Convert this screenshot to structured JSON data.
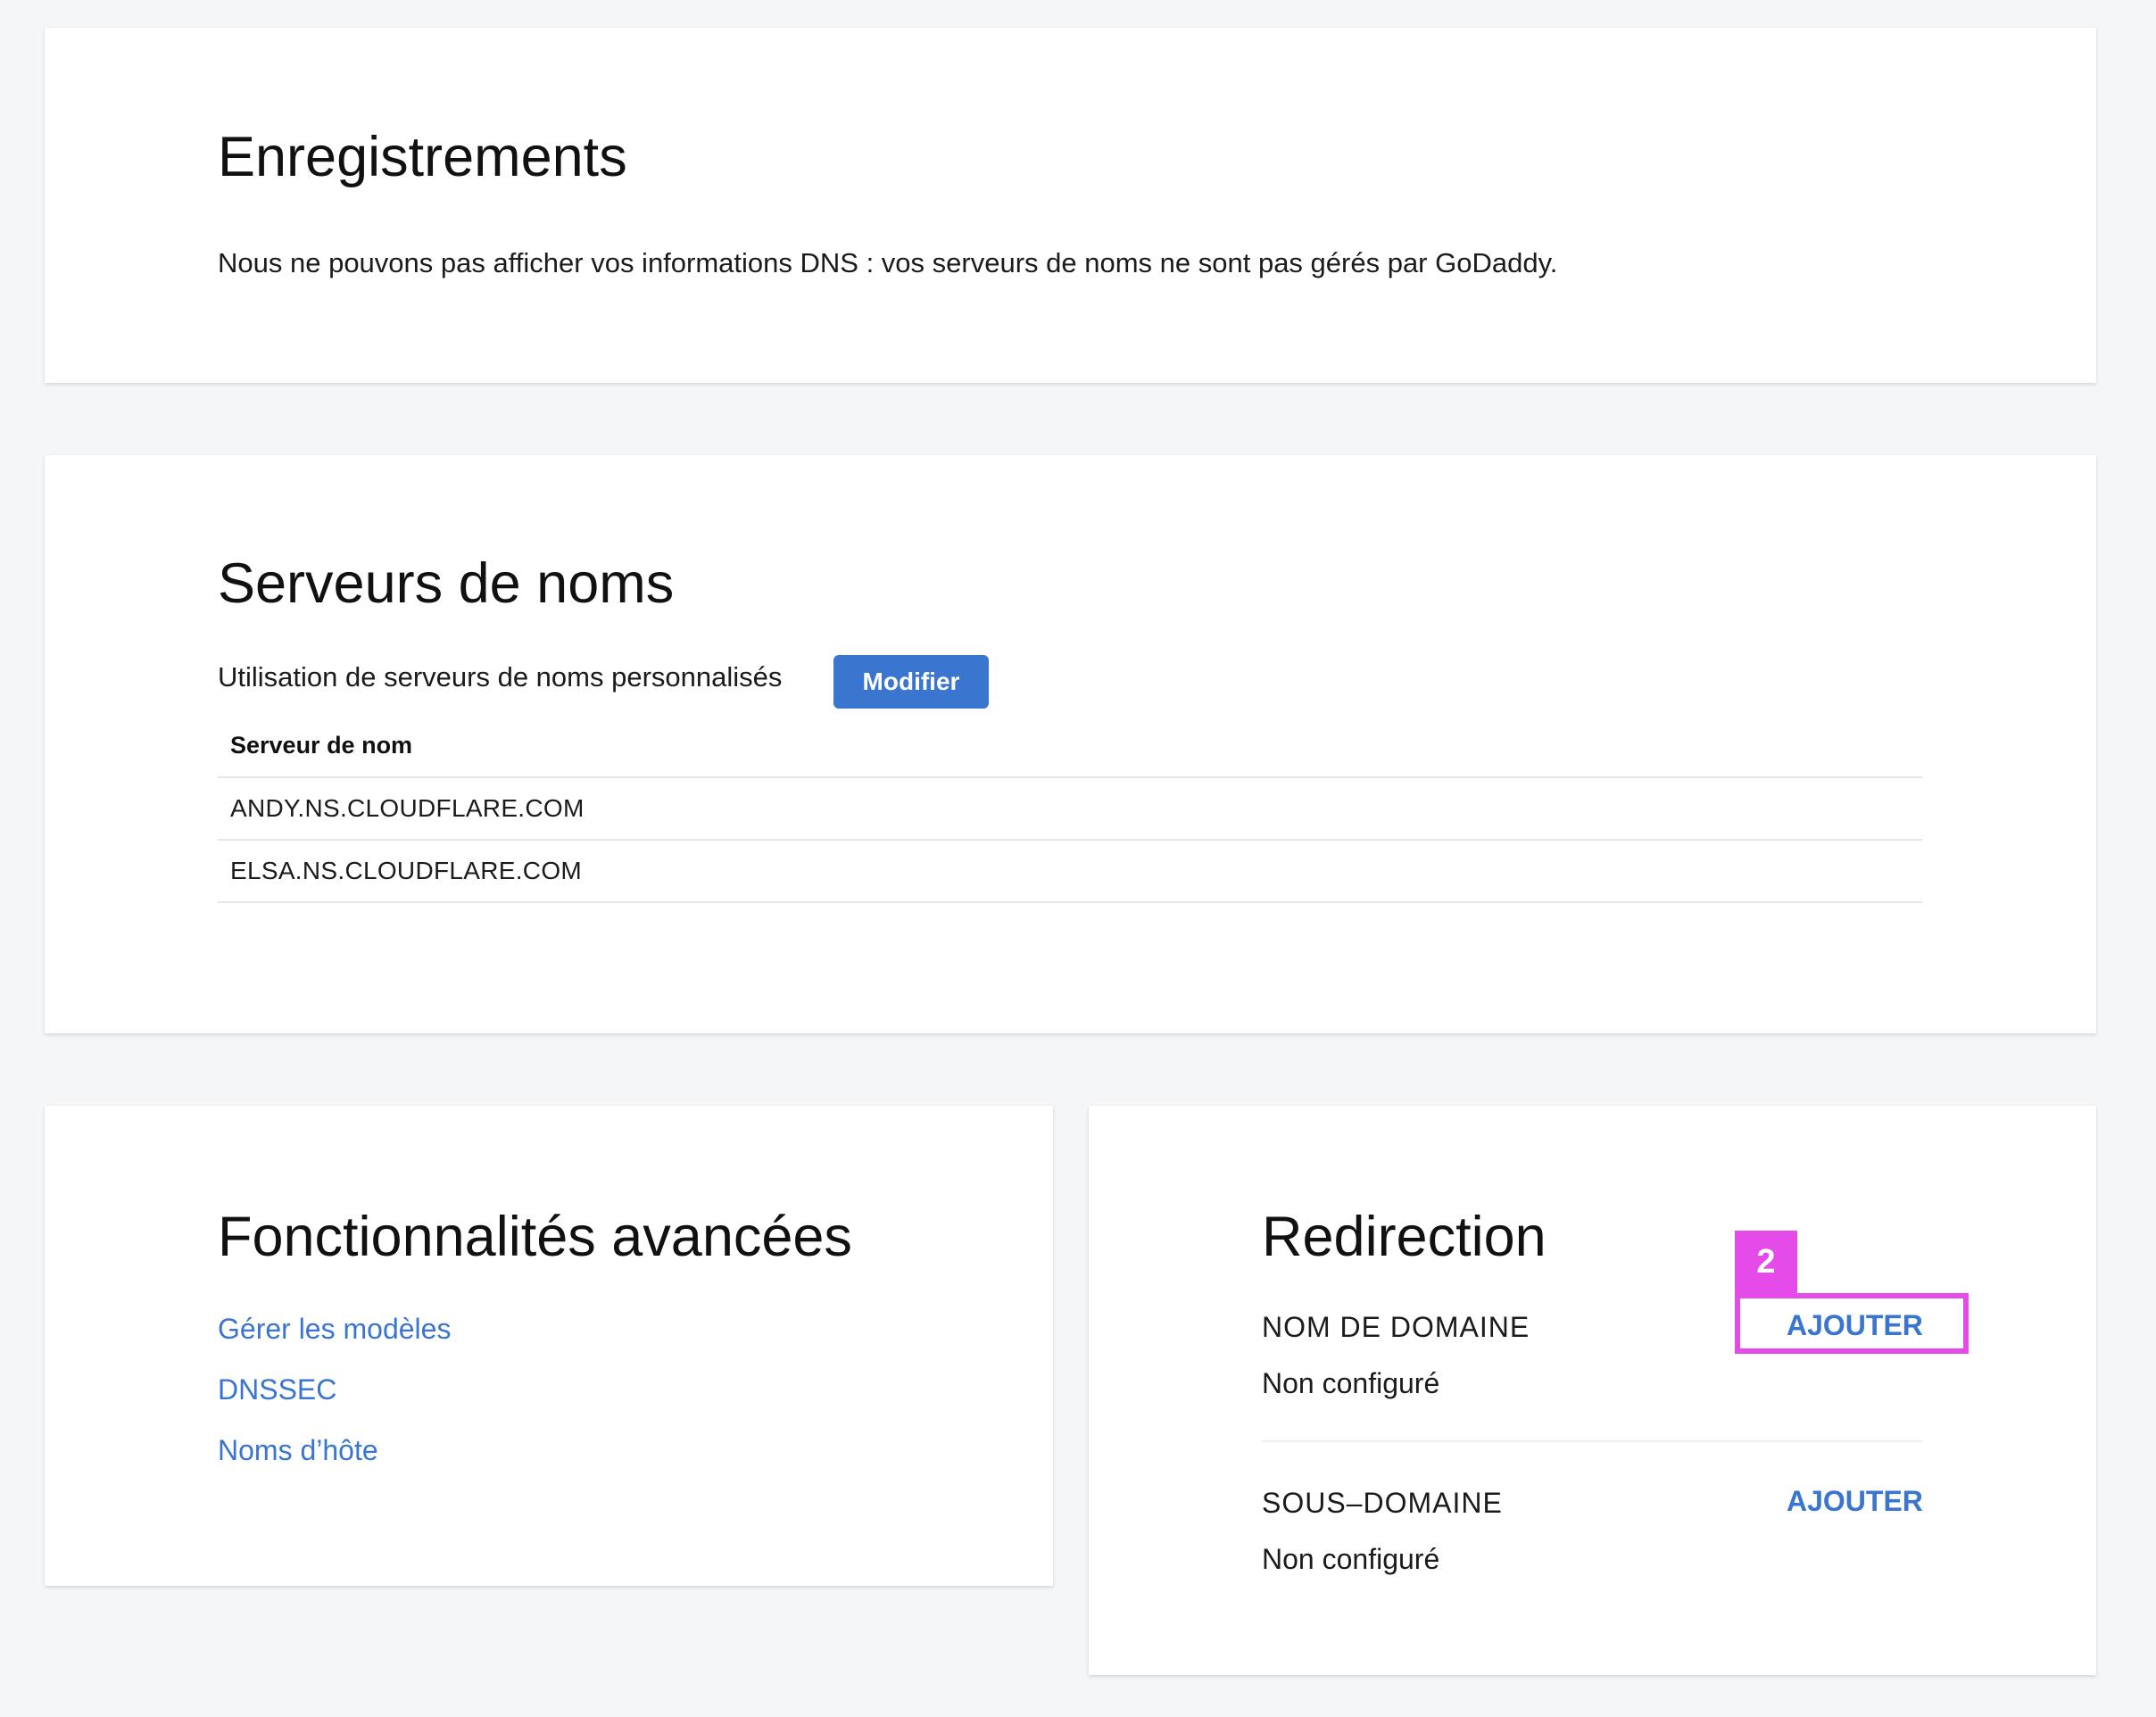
{
  "records": {
    "title": "Enregistrements",
    "message": "Nous ne pouvons pas afficher vos informations DNS : vos serveurs de noms ne sont pas gérés par GoDaddy."
  },
  "nameservers": {
    "title": "Serveurs de noms",
    "status_text": "Utilisation de serveurs de noms personnalisés",
    "modify_label": "Modifier",
    "column_header": "Serveur de nom",
    "rows": [
      "ANDY.NS.CLOUDFLARE.COM",
      "ELSA.NS.CLOUDFLARE.COM"
    ]
  },
  "advanced": {
    "title": "Fonctionnalités avancées",
    "links": [
      "Gérer les modèles",
      "DNSSEC",
      "Noms d’hôte"
    ]
  },
  "forwarding": {
    "title": "Redirection",
    "domain": {
      "label": "NOM DE DOMAINE",
      "status": "Non configuré",
      "add_label": "AJOUTER"
    },
    "subdomain": {
      "label": "SOUS–DOMAINE",
      "status": "Non configuré",
      "add_label": "AJOUTER"
    }
  },
  "annotation": {
    "badge_number": "2",
    "color": "#e54be8"
  },
  "colors": {
    "page_background": "#f5f6f8",
    "link_blue": "#3a75cf",
    "button_blue": "#3a75cf"
  }
}
